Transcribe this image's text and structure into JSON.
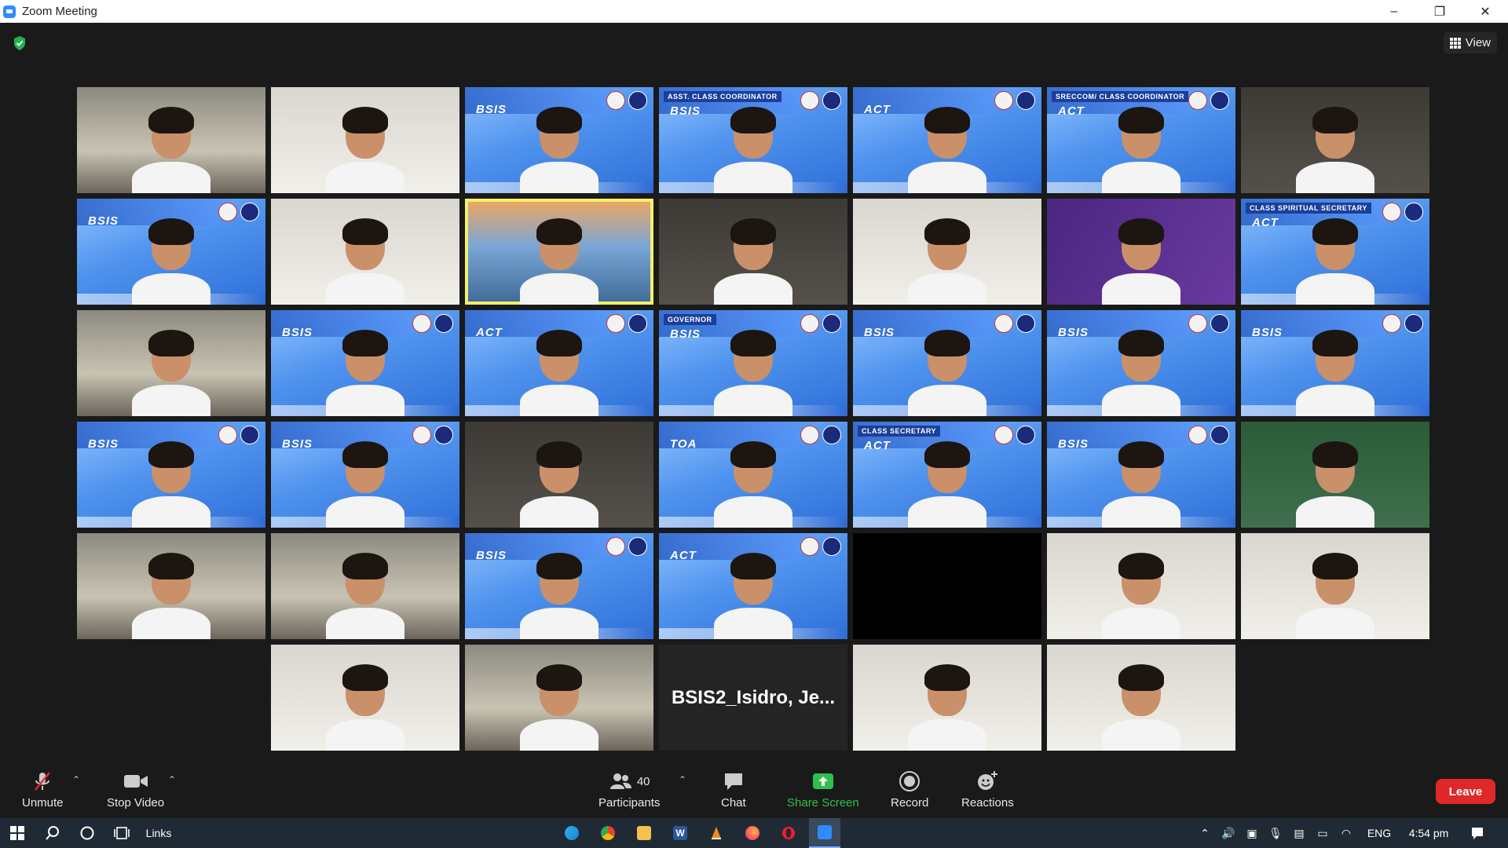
{
  "window": {
    "title": "Zoom Meeting",
    "controls": [
      "–",
      "❐",
      "✕"
    ]
  },
  "view_button": {
    "label": "View"
  },
  "tiles": [
    {
      "bg": "room",
      "label": "",
      "role": ""
    },
    {
      "bg": "white",
      "label": "",
      "role": ""
    },
    {
      "bg": "blue",
      "label": "BSIS",
      "role": ""
    },
    {
      "bg": "blue",
      "label": "BSIS",
      "role": "ASST. CLASS COORDINATOR"
    },
    {
      "bg": "blue",
      "label": "ACT",
      "role": ""
    },
    {
      "bg": "blue",
      "label": "ACT",
      "role": "SRECCOM/ CLASS COORDINATOR"
    },
    {
      "bg": "dark",
      "label": "",
      "role": ""
    },
    {
      "bg": "blue",
      "label": "BSIS",
      "role": ""
    },
    {
      "bg": "white",
      "label": "",
      "role": ""
    },
    {
      "bg": "sunset",
      "label": "",
      "role": "",
      "active": true
    },
    {
      "bg": "dark",
      "label": "",
      "role": ""
    },
    {
      "bg": "white",
      "label": "",
      "role": ""
    },
    {
      "bg": "purple",
      "label": "",
      "role": ""
    },
    {
      "bg": "blue",
      "label": "ACT",
      "role": "CLASS SPIRITUAL SECRETARY"
    },
    {
      "bg": "room",
      "label": "",
      "role": ""
    },
    {
      "bg": "blue",
      "label": "BSIS",
      "role": ""
    },
    {
      "bg": "blue",
      "label": "ACT",
      "role": ""
    },
    {
      "bg": "blue",
      "label": "BSIS",
      "role": "GOVERNOR"
    },
    {
      "bg": "blue",
      "label": "BSIS",
      "role": ""
    },
    {
      "bg": "blue",
      "label": "BSIS",
      "role": ""
    },
    {
      "bg": "blue",
      "label": "BSIS",
      "role": ""
    },
    {
      "bg": "blue",
      "label": "BSIS",
      "role": ""
    },
    {
      "bg": "blue",
      "label": "BSIS",
      "role": ""
    },
    {
      "bg": "dark",
      "label": "",
      "role": ""
    },
    {
      "bg": "blue",
      "label": "TOA",
      "role": ""
    },
    {
      "bg": "blue",
      "label": "ACT",
      "role": "CLASS SECRETARY"
    },
    {
      "bg": "blue",
      "label": "BSIS",
      "role": ""
    },
    {
      "bg": "green",
      "label": "",
      "role": ""
    },
    {
      "bg": "room",
      "label": "",
      "role": ""
    },
    {
      "bg": "room",
      "label": "",
      "role": ""
    },
    {
      "bg": "blue",
      "label": "BSIS",
      "role": ""
    },
    {
      "bg": "blue",
      "label": "ACT",
      "role": ""
    },
    {
      "bg": "black",
      "label": "",
      "role": ""
    },
    {
      "bg": "white",
      "label": "",
      "role": ""
    },
    {
      "bg": "white",
      "label": "",
      "role": ""
    },
    {
      "bg": "white",
      "label": "",
      "role": ""
    },
    {
      "bg": "room",
      "label": "",
      "role": ""
    },
    {
      "bg": "plain",
      "label": "",
      "role": "",
      "name": "BSIS2_Isidro,  Je..."
    },
    {
      "bg": "white",
      "label": "",
      "role": ""
    },
    {
      "bg": "white",
      "label": "",
      "role": ""
    }
  ],
  "toolbar": {
    "unmute": "Unmute",
    "stop_video": "Stop Video",
    "participants": "Participants",
    "participant_count": "40",
    "chat": "Chat",
    "share_screen": "Share Screen",
    "record": "Record",
    "reactions": "Reactions",
    "leave": "Leave"
  },
  "taskbar": {
    "links": "Links",
    "lang": "ENG",
    "time": "4:54 pm"
  },
  "colors": {
    "share_green": "#2ec14e",
    "leave_red": "#e02828",
    "active_speaker": "#f3f06d"
  }
}
